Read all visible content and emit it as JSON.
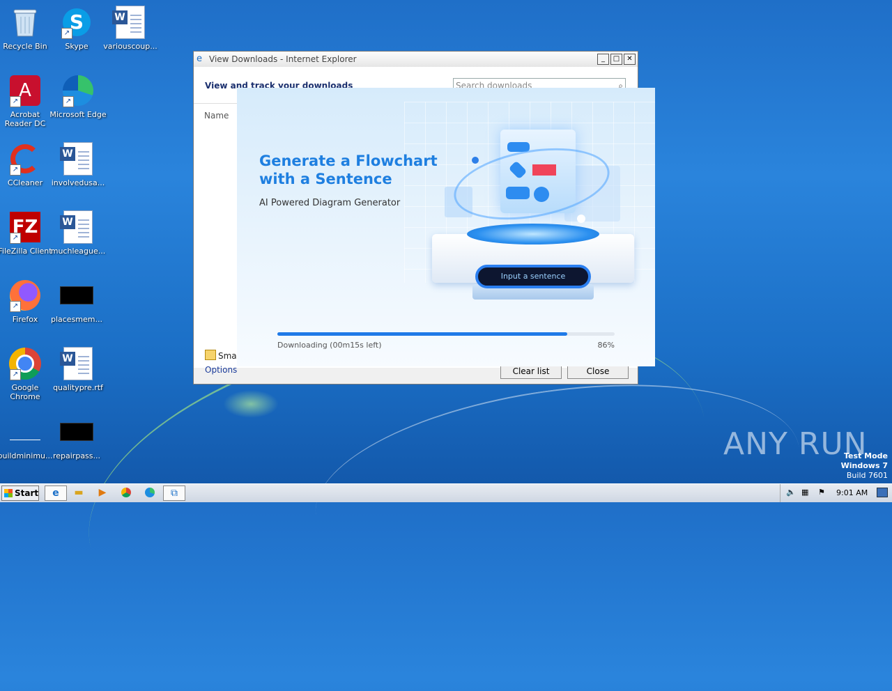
{
  "desktop": {
    "icons": [
      {
        "label": "Recycle Bin"
      },
      {
        "label": "Skype"
      },
      {
        "label": "variouscoup..."
      },
      {
        "label": "Acrobat Reader DC"
      },
      {
        "label": "Microsoft Edge"
      },
      {
        "label": "CCleaner"
      },
      {
        "label": "involvedusa..."
      },
      {
        "label": "FileZilla Client"
      },
      {
        "label": "muchleague..."
      },
      {
        "label": "Firefox"
      },
      {
        "label": "placesmem..."
      },
      {
        "label": "Google Chrome"
      },
      {
        "label": "qualitypre.rtf"
      },
      {
        "label": "buildminimu..."
      },
      {
        "label": "repairpass..."
      }
    ]
  },
  "ie_window": {
    "title": "View Downloads - Internet Explorer",
    "heading": "View and track your downloads",
    "search_placeholder": "Search downloads",
    "column_name": "Name",
    "smartscreen": "Smar",
    "options": "Options",
    "clear_list": "Clear list",
    "close": "Close"
  },
  "installer": {
    "headline_line1": "Generate a Flowchart",
    "headline_line2": "with a Sentence",
    "subline": "AI Powered Diagram Generator",
    "input_text": "Input a sentence",
    "status": "Downloading (00m15s left)",
    "percent_label": "86%",
    "progress": 0.86,
    "accent_color": "#1f7ae8"
  },
  "watermark": {
    "brand": "ANY RUN",
    "line1": "Test Mode",
    "line2": "Windows 7",
    "line3": "Build 7601"
  },
  "taskbar": {
    "start": "Start",
    "clock": "9:01 AM"
  }
}
